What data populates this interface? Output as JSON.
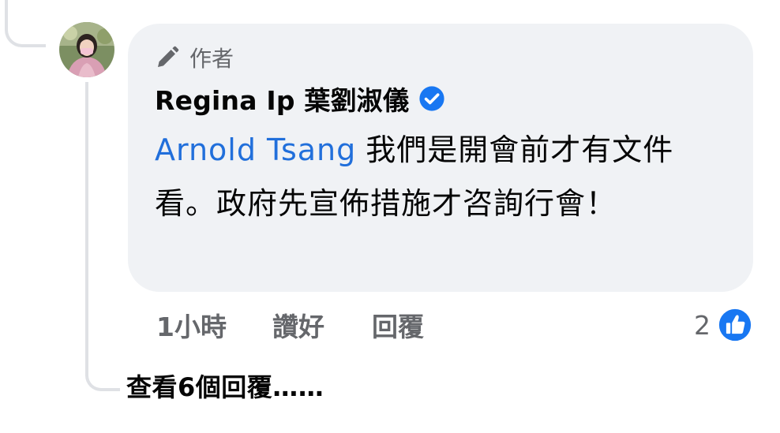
{
  "comment": {
    "author_badge": "作者",
    "author_name": "Regina Ip 葉劉淑儀",
    "mention": "Arnold Tsang",
    "text": "我們是開會前才有文件看。政府先宣佈措施才咨詢行會！"
  },
  "actions": {
    "time": "1小時",
    "like_label": "讚好",
    "reply_label": "回覆"
  },
  "reactions": {
    "count": "2"
  },
  "view_replies": "查看6個回覆……",
  "colors": {
    "bubble": "#f0f2f5",
    "mention": "#216fdb",
    "verified": "#1877f2",
    "like_icon": "#1877f2",
    "muted_text": "#65676b"
  },
  "icons": [
    "pen-icon",
    "verified-badge-icon",
    "like-reaction-icon"
  ]
}
